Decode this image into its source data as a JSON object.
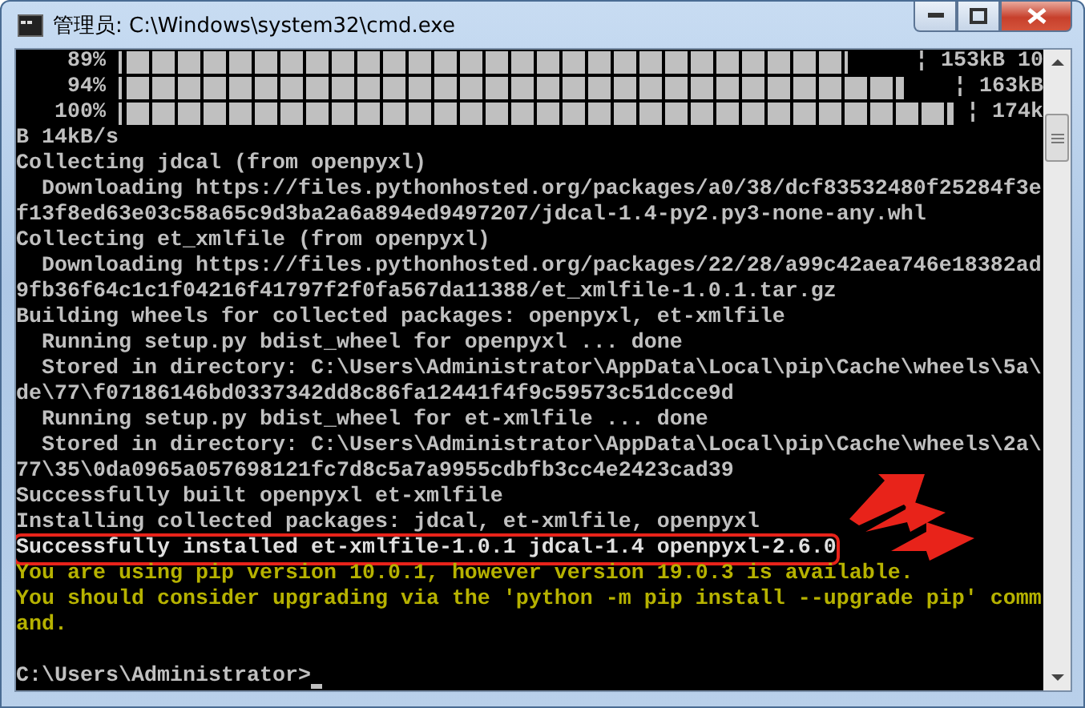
{
  "window": {
    "title": "管理员: C:\\Windows\\system32\\cmd.exe"
  },
  "progress_rows": [
    {
      "percent": "89%",
      "level": 0.93,
      "tail": "¦ 153kB 10"
    },
    {
      "percent": "94%",
      "level": 0.955,
      "tail": "¦ 163kB"
    },
    {
      "percent": "100%",
      "level": 1,
      "tail": "¦ 174k"
    }
  ],
  "lines": [
    {
      "kind": "normal",
      "text": "B 14kB/s"
    },
    {
      "kind": "normal",
      "text": "Collecting jdcal (from openpyxl)"
    },
    {
      "kind": "normal",
      "text": "  Downloading https://files.pythonhosted.org/packages/a0/38/dcf83532480f25284f3e"
    },
    {
      "kind": "normal",
      "text": "f13f8ed63e03c58a65c9d3ba2a6a894ed9497207/jdcal-1.4-py2.py3-none-any.whl"
    },
    {
      "kind": "normal",
      "text": "Collecting et_xmlfile (from openpyxl)"
    },
    {
      "kind": "normal",
      "text": "  Downloading https://files.pythonhosted.org/packages/22/28/a99c42aea746e18382ad"
    },
    {
      "kind": "normal",
      "text": "9fb36f64c1c1f04216f41797f2f0fa567da11388/et_xmlfile-1.0.1.tar.gz"
    },
    {
      "kind": "normal",
      "text": "Building wheels for collected packages: openpyxl, et-xmlfile"
    },
    {
      "kind": "normal",
      "text": "  Running setup.py bdist_wheel for openpyxl ... done"
    },
    {
      "kind": "normal",
      "text": "  Stored in directory: C:\\Users\\Administrator\\AppData\\Local\\pip\\Cache\\wheels\\5a\\"
    },
    {
      "kind": "normal",
      "text": "de\\77\\f07186146bd0337342dd8c86fa12441f4f9c59573c51dcce9d"
    },
    {
      "kind": "normal",
      "text": "  Running setup.py bdist_wheel for et-xmlfile ... done"
    },
    {
      "kind": "normal",
      "text": "  Stored in directory: C:\\Users\\Administrator\\AppData\\Local\\pip\\Cache\\wheels\\2a\\"
    },
    {
      "kind": "normal",
      "text": "77\\35\\0da0965a057698121fc7d8c5a7a9955cdbfb3cc4e2423cad39"
    },
    {
      "kind": "normal",
      "text": "Successfully built openpyxl et-xmlfile"
    },
    {
      "kind": "normal",
      "text": "Installing collected packages: jdcal, et-xmlfile, openpyxl"
    },
    {
      "kind": "highlighted",
      "text": "Successfully installed et-xmlfile-1.0.1 jdcal-1.4 openpyxl-2.6.0"
    },
    {
      "kind": "warning",
      "text": "You are using pip version 10.0.1, however version 19.0.3 is available."
    },
    {
      "kind": "warning",
      "text": "You should consider upgrading via the 'python -m pip install --upgrade pip' comm"
    },
    {
      "kind": "warning",
      "text": "and."
    },
    {
      "kind": "blank"
    },
    {
      "kind": "prompt",
      "text": "C:\\Users\\Administrator>"
    }
  ]
}
